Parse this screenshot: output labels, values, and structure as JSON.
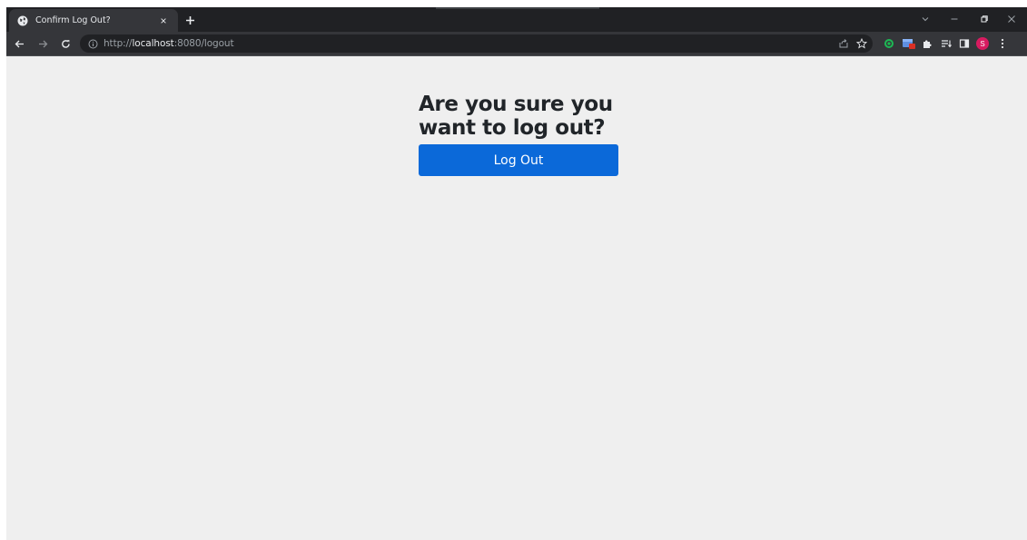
{
  "browser": {
    "tab": {
      "title": "Confirm Log Out?",
      "favicon": "globe-icon",
      "close": "×"
    },
    "new_tab": "+",
    "address": {
      "scheme": "http://",
      "host": "localhost",
      "rest": ":8080/logout"
    },
    "profile_initial": "S",
    "colors": {
      "tabstrip": "#202124",
      "toolbar": "#35363a",
      "profile": "#d81b60"
    }
  },
  "page": {
    "heading": "Are you sure you want to log out?",
    "button_label": "Log Out",
    "colors": {
      "background": "#efefef",
      "button": "#0b69d9",
      "heading": "#212529"
    }
  }
}
